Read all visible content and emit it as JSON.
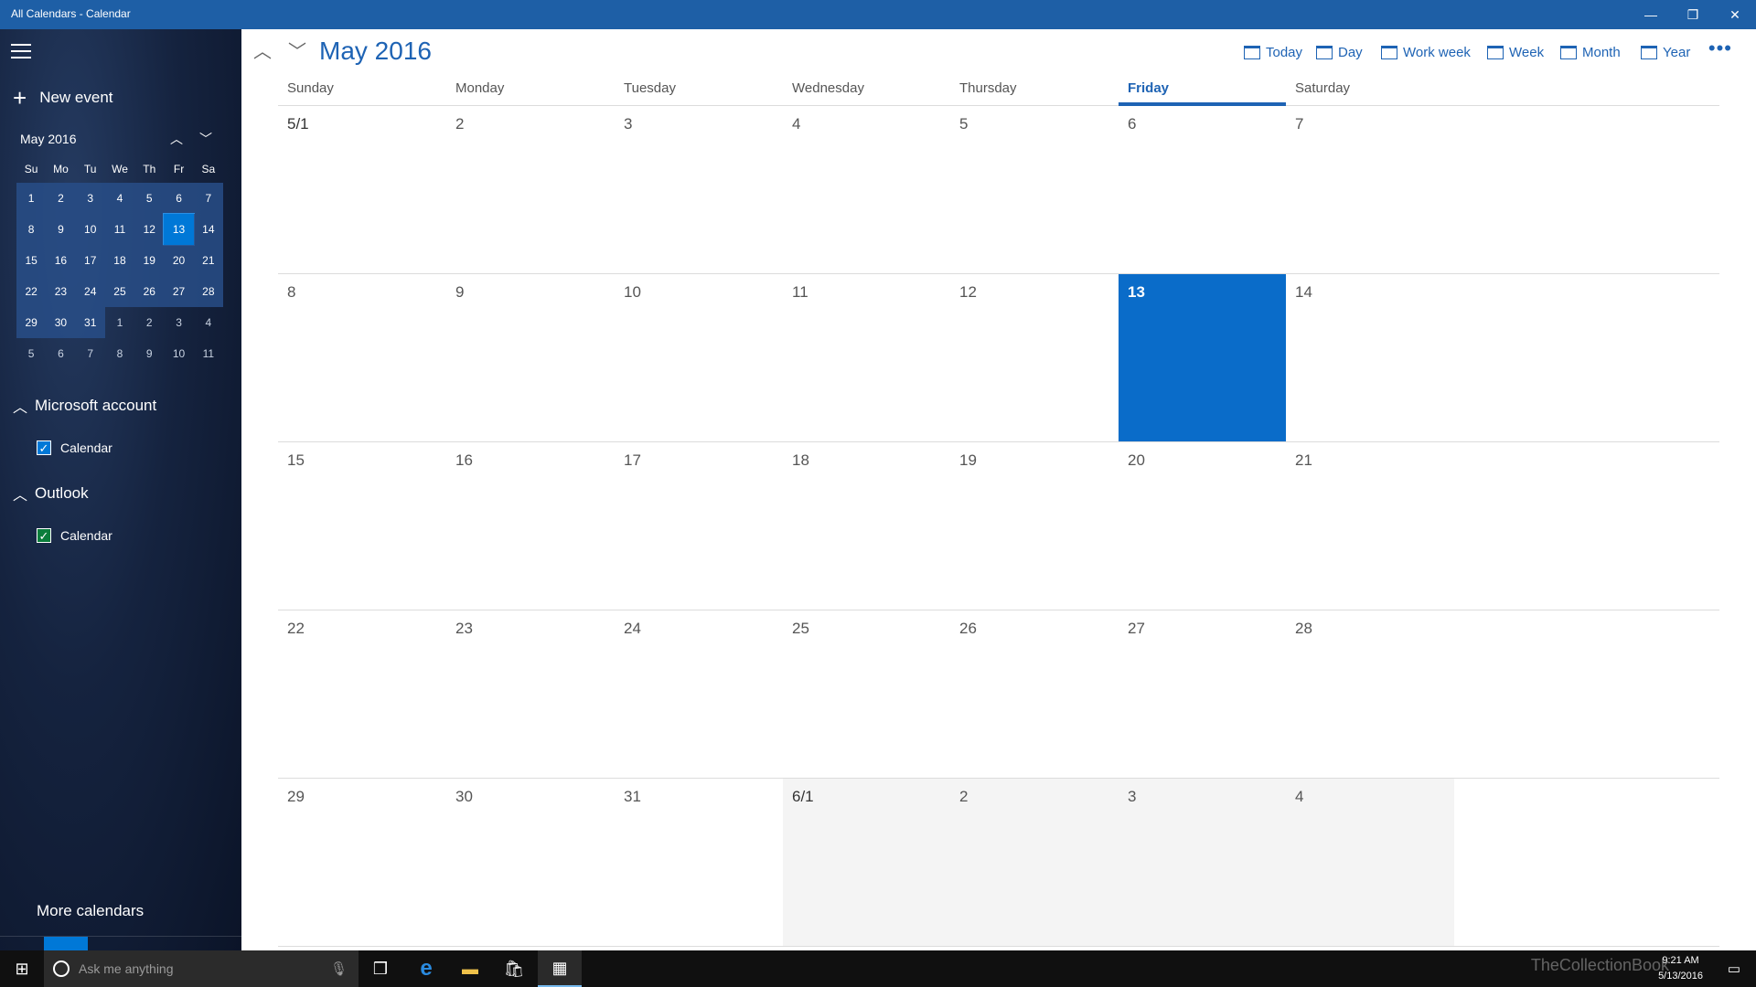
{
  "window": {
    "title": "All Calendars - Calendar",
    "minimize": "—",
    "restore": "❐",
    "close": "✕"
  },
  "sidebar": {
    "new_event_label": "New event",
    "mini_calendar": {
      "title": "May 2016",
      "day_headers": [
        "Su",
        "Mo",
        "Tu",
        "We",
        "Th",
        "Fr",
        "Sa"
      ],
      "weeks": [
        [
          "1",
          "2",
          "3",
          "4",
          "5",
          "6",
          "7"
        ],
        [
          "8",
          "9",
          "10",
          "11",
          "12",
          "13",
          "14"
        ],
        [
          "15",
          "16",
          "17",
          "18",
          "19",
          "20",
          "21"
        ],
        [
          "22",
          "23",
          "24",
          "25",
          "26",
          "27",
          "28"
        ],
        [
          "29",
          "30",
          "31",
          "1",
          "2",
          "3",
          "4"
        ],
        [
          "5",
          "6",
          "7",
          "8",
          "9",
          "10",
          "11"
        ]
      ],
      "selected_day": "13"
    },
    "accounts": [
      {
        "name": "Microsoft account",
        "calendar_label": "Calendar",
        "color": "#0078d7"
      },
      {
        "name": "Outlook",
        "calendar_label": "Calendar",
        "color": "#0a7d3b"
      }
    ],
    "more_calendars_label": "More calendars"
  },
  "header": {
    "month_title": "May 2016",
    "views": [
      "Today",
      "Day",
      "Work week",
      "Week",
      "Month",
      "Year"
    ],
    "more_label": "•••"
  },
  "month_view": {
    "day_names": [
      "Sunday",
      "Monday",
      "Tuesday",
      "Wednesday",
      "Thursday",
      "Friday",
      "Saturday"
    ],
    "current_day_name": "Friday",
    "weeks": [
      [
        "5/1",
        "2",
        "3",
        "4",
        "5",
        "6",
        "7"
      ],
      [
        "8",
        "9",
        "10",
        "11",
        "12",
        "13",
        "14"
      ],
      [
        "15",
        "16",
        "17",
        "18",
        "19",
        "20",
        "21"
      ],
      [
        "22",
        "23",
        "24",
        "25",
        "26",
        "27",
        "28"
      ],
      [
        "29",
        "30",
        "31",
        "6/1",
        "2",
        "3",
        "4"
      ]
    ],
    "today": "13",
    "accent_color": "#0a6cc9"
  },
  "taskbar": {
    "search_placeholder": "Ask me anything",
    "time": "9:21 AM",
    "date": "5/13/2016",
    "watermark": "TheCollectionBook"
  }
}
